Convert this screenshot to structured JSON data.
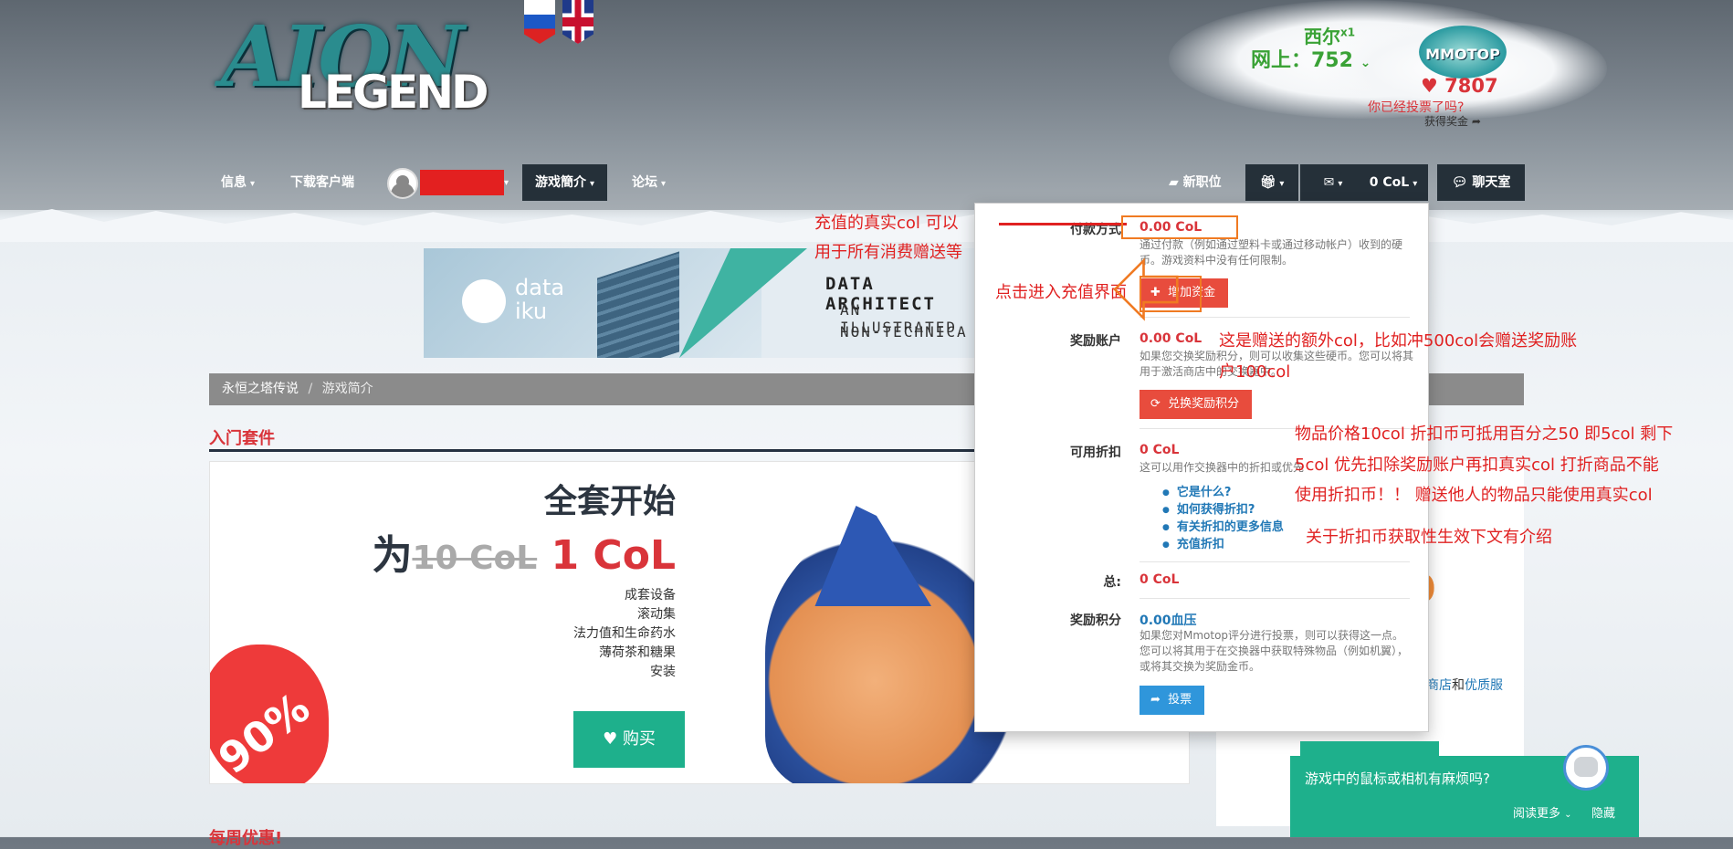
{
  "header": {
    "logo_main": "AION",
    "logo_sub": "LEGEND",
    "online_name": "西尔",
    "online_name_sup": "x1",
    "online_label": "网上：752",
    "mmotop": "MMOTOP",
    "votes": "7807",
    "vote_question": "你已经投票了吗?",
    "reward": "获得奖金"
  },
  "nav": {
    "info": "信息",
    "download": "下载客户端",
    "game_intro": "游戏簡介",
    "forum": "论坛",
    "news": "新职位",
    "col_balance": "0 CoL",
    "chat": "聊天室"
  },
  "banner": {
    "brand": "data iku",
    "line1": "DATA ARCHITECT",
    "line2": "AN ILLUSTRATED",
    "line3": "NON-TECHNICA"
  },
  "breadcrumb": {
    "home": "永恒之塔传说",
    "sep": "/",
    "current": "游戏简介"
  },
  "starter": {
    "section": "入门套件",
    "title": "全套开始",
    "price_prefix": "为",
    "price_old": "10 CoL",
    "price_new": "1 CoL",
    "features": [
      "成套设备",
      "滚动集",
      "法力值和生命药水",
      "薄荷茶和糖果",
      "安装"
    ],
    "discount": "90%",
    "buy": "购买"
  },
  "sidebar": {
    "link1": "商店",
    "and": "和",
    "link2": "优质服"
  },
  "bottom_section": "每周优惠!",
  "panel": {
    "payment_label": "付款方式",
    "payment_value": "0.00 CoL",
    "payment_desc": "通过付款（例如通过塑料卡或通过移动帐户）收到的硬币。游戏资料中没有任何限制。",
    "add_funds": "增加资金",
    "bonus_label": "奖励账户",
    "bonus_value": "0.00 CoL",
    "bonus_desc": "如果您交换奖励积分，则可以收集这些硬币。您可以将其用于激活商店中的交换器中。",
    "exchange_btn": "兑换奖励积分",
    "discount_label": "可用折扣",
    "discount_value": "0 CoL",
    "discount_desc": "这可以用作交换器中的折扣或优先",
    "discount_links": [
      "它是什么?",
      "如何获得折扣?",
      "有关折扣的更多信息",
      "充值折扣"
    ],
    "total_label": "总:",
    "total_value": "0 CoL",
    "points_label": "奖励积分",
    "points_value": "0.00血压",
    "points_desc": "如果您对Mmotop评分进行投票，则可以获得这一点。您可以将其用于在交换器中获取特殊物品（例如机翼），或将其交换为奖励金币。",
    "vote_btn": "投票"
  },
  "annotations": {
    "a1": "充值的真实col 可以",
    "a2": "用于所有消费赠送等",
    "a3": "点击进入充值界面",
    "a4": "这是赠送的额外col，比如冲500col会赠送奖励账",
    "a5": "户100col",
    "a6": "物品价格10col 折扣币可抵用百分之50 即5col 剩下",
    "a7": "5col 优先扣除奖励账户再扣真实col  打折商品不能",
    "a8": "使用折扣币！！ 赠送他人的物品只能使用真实col",
    "a9": "关于折扣币获取性生效下文有介绍"
  },
  "chat_popup": {
    "question": "游戏中的鼠标或相机有麻烦吗?",
    "more": "阅读更多",
    "hide": "隐藏"
  },
  "colors": {
    "accent_red": "#d9343a",
    "teal": "#1eb08c",
    "dark_nav": "#253039",
    "link_blue": "#2178b6"
  }
}
